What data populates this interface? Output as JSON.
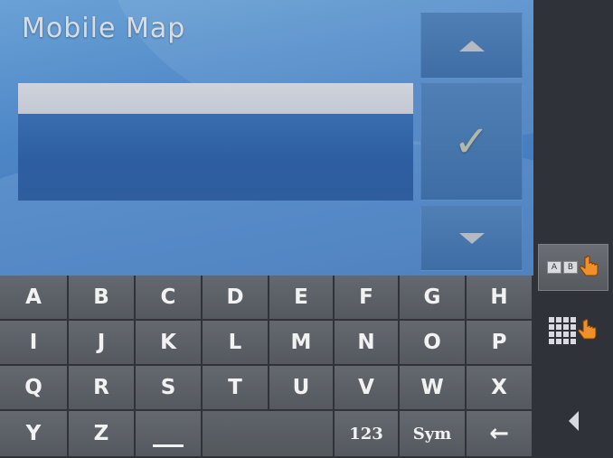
{
  "app": {
    "title": "Mobile Map"
  },
  "search": {
    "value": ""
  },
  "keyboard": {
    "rows": [
      [
        "A",
        "B",
        "C",
        "D",
        "E",
        "F",
        "G",
        "H"
      ],
      [
        "I",
        "J",
        "K",
        "L",
        "M",
        "N",
        "O",
        "P"
      ],
      [
        "Q",
        "R",
        "S",
        "T",
        "U",
        "V",
        "W",
        "X"
      ]
    ],
    "bottom": {
      "y": "Y",
      "z": "Z",
      "num": "123",
      "sym": "Sym",
      "backspace": "←"
    }
  },
  "icons": {
    "scroll_up": "triangle-up-icon",
    "confirm": "checkmark-icon",
    "scroll_down": "triangle-down-icon",
    "abc_mode": "ab-keyboard-icon",
    "grid_mode": "grid-keyboard-icon",
    "back": "triangle-left-icon"
  },
  "colors": {
    "display_bg": "#4d86c6",
    "key_bg": "#5c6167",
    "key_text": "#f2f2f2",
    "input_bg": "#cfd3dc",
    "hand": "#f0902a"
  }
}
